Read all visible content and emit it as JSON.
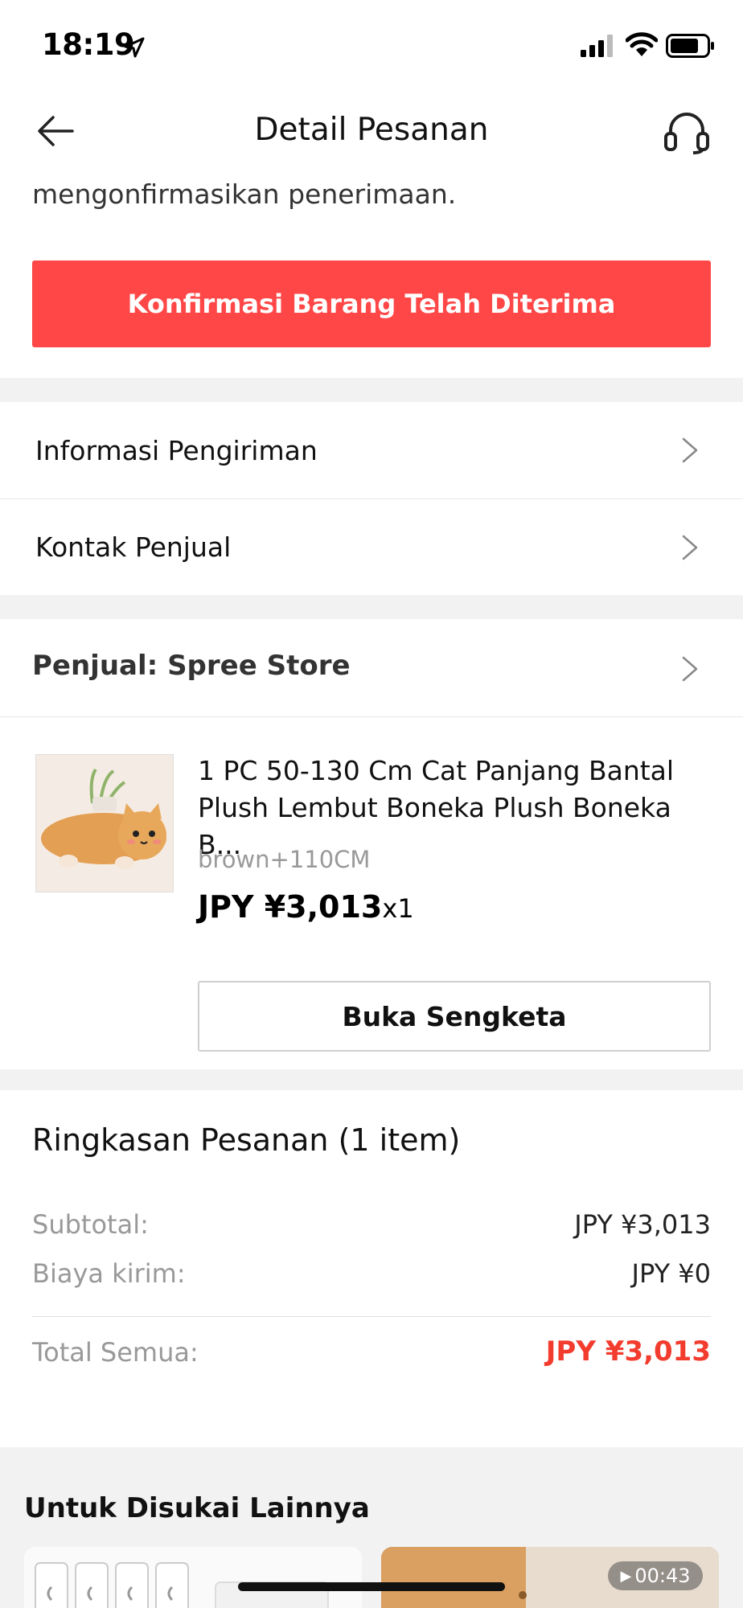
{
  "status_bar": {
    "time": "18:19"
  },
  "header": {
    "title": "Detail Pesanan"
  },
  "confirm": {
    "message": "mengonfirmasikan penerimaan.",
    "button_label": "Konfirmasi Barang Telah Diterima",
    "button_color": "#ff4747"
  },
  "rows": [
    {
      "label": "Informasi Pengiriman"
    },
    {
      "label": "Kontak Penjual"
    }
  ],
  "seller": {
    "label": "Penjual: Spree Store"
  },
  "product": {
    "title": "1 PC 50-130 Cm Cat Panjang Bantal Plush Lembut Boneka Plush Boneka B...",
    "variant": "brown+110CM",
    "price": "JPY ¥3,013",
    "quantity": "x1",
    "dispute_label": "Buka Sengketa"
  },
  "summary": {
    "title": "Ringkasan Pesanan (1 item)",
    "subtotal_label": "Subtotal:",
    "subtotal_value": "JPY ¥3,013",
    "shipping_label": "Biaya kirim:",
    "shipping_value": "JPY ¥0",
    "total_label": "Total Semua:",
    "total_value": "JPY ¥3,013",
    "total_color": "#f23c2e"
  },
  "recommendations": {
    "title": "Untuk Disukai Lainnya",
    "video_duration": "00:43"
  }
}
